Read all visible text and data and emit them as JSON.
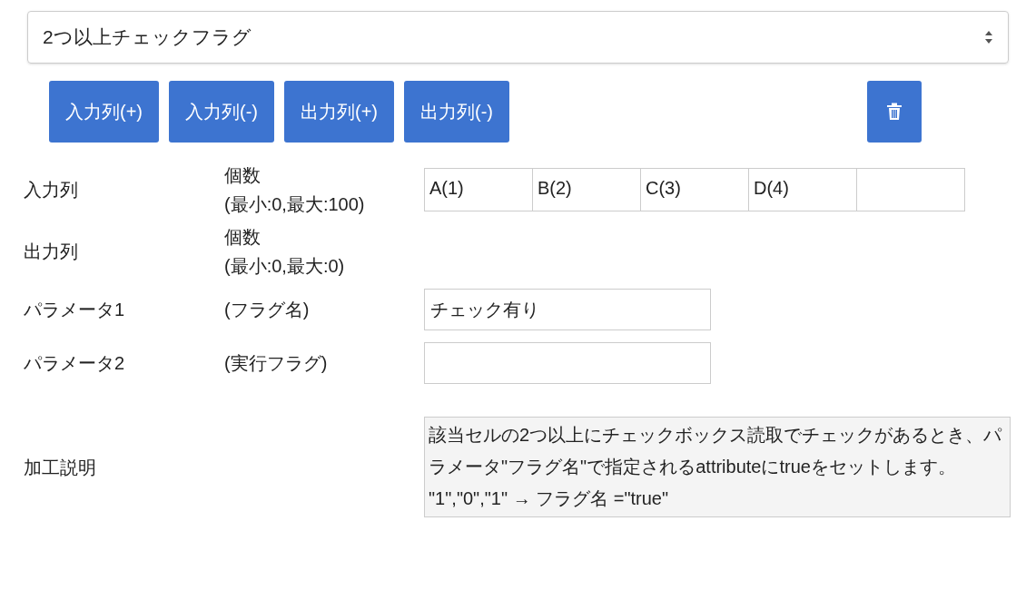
{
  "select": {
    "value": "2つ以上チェックフラグ"
  },
  "buttons": [
    {
      "kind": "text",
      "label": "入力列(+)"
    },
    {
      "kind": "text",
      "label": "入力列(-)"
    },
    {
      "kind": "text",
      "label": "出力列(+)"
    },
    {
      "kind": "text",
      "label": "出力列(-)"
    },
    {
      "kind": "delete"
    }
  ],
  "rows": [
    {
      "kind": "columns",
      "label": "入力列",
      "hint_lines": [
        "個数",
        "(最小:0,最大:100)"
      ],
      "cells": [
        {
          "kind": "filled",
          "value": "A(1)"
        },
        {
          "kind": "filled",
          "value": "B(2)"
        },
        {
          "kind": "filled",
          "value": "C(3)"
        },
        {
          "kind": "filled",
          "value": "D(4)"
        },
        {
          "kind": "empty"
        }
      ]
    },
    {
      "kind": "columns",
      "label": "出力列",
      "hint_lines": [
        "個数",
        "(最小:0,最大:0)"
      ]
    },
    {
      "kind": "param",
      "label": "パラメータ1",
      "hint_lines": [
        "(フラグ名)"
      ],
      "value": "チェック有り"
    },
    {
      "kind": "param",
      "label": "パラメータ2",
      "hint_lines": [
        "(実行フラグ)"
      ]
    },
    {
      "kind": "description",
      "label": "加工説明",
      "lines": [
        "該当セルの2つ以上にチェックボックス読取でチェックがあるとき、パラメータ\"フラグ名\"で指定されるattributeにtrueをセットします。",
        "\"1\",\"0\",\"1\" → フラグ名 =\"true\""
      ]
    }
  ]
}
